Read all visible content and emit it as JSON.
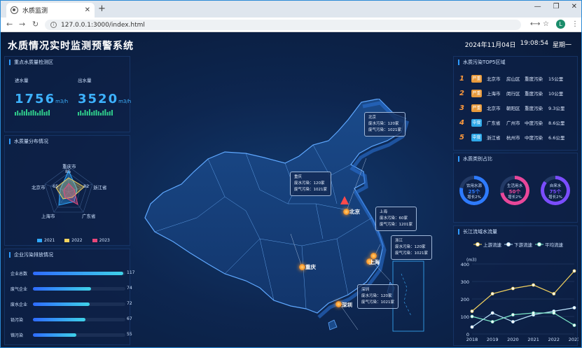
{
  "browser": {
    "tab_title": "水质监测",
    "url": "127.0.0.1:3000/index.html",
    "avatar_letter": "L"
  },
  "header": {
    "title": "水质情况实时监测预警系统",
    "date": "2024年11月04日",
    "time": "19:08:54",
    "weekday": "星期一"
  },
  "panel_inflow": {
    "title": "重点水质量检测区",
    "inflow_label": "进水量",
    "inflow_value": "1756",
    "outflow_label": "出水量",
    "outflow_value": "3520",
    "unit": "m3/h"
  },
  "panel_radar": {
    "title": "水质量分布情况",
    "axes": [
      "重庆市",
      "浙江省",
      "广东省",
      "上海市",
      "北京市"
    ],
    "label_85": "85",
    "label_82": "82",
    "label_65": "65",
    "legend": [
      "2021",
      "2022",
      "2023"
    ],
    "legend_colors": [
      "#2ea8ff",
      "#f4d35e",
      "#e8477a"
    ]
  },
  "panel_enterprise": {
    "title": "企业污染排放情况",
    "rows": [
      {
        "label": "企业总数",
        "value": 117,
        "pct": 0.98
      },
      {
        "label": "废气企业",
        "value": 74,
        "pct": 0.63
      },
      {
        "label": "废水企业",
        "value": 72,
        "pct": 0.61
      },
      {
        "label": "铅污染",
        "value": 67,
        "pct": 0.57
      },
      {
        "label": "铬污染",
        "value": 55,
        "pct": 0.47
      }
    ]
  },
  "panel_top5": {
    "title": "水质污染TOP5区域",
    "rows": [
      {
        "n": "1",
        "level": "严重",
        "prov": "北京市",
        "district": "房山区",
        "kind": "重度污染",
        "dist": "15公里",
        "color": "#e89a3c"
      },
      {
        "n": "2",
        "level": "严重",
        "prov": "上海市",
        "district": "闵行区",
        "kind": "重度污染",
        "dist": "10公里",
        "color": "#e89a3c"
      },
      {
        "n": "3",
        "level": "严重",
        "prov": "北京市",
        "district": "朝阳区",
        "kind": "重度污染",
        "dist": "9.3公里",
        "color": "#e89a3c"
      },
      {
        "n": "4",
        "level": "中度",
        "prov": "广东省",
        "district": "广州市",
        "kind": "中度污染",
        "dist": "8.6公里",
        "color": "#2ea8e8"
      },
      {
        "n": "5",
        "level": "中度",
        "prov": "浙江省",
        "district": "杭州市",
        "kind": "中度污染",
        "dist": "6.6公里",
        "color": "#2ea8e8"
      }
    ]
  },
  "panel_types": {
    "title": "水质类别占比",
    "rings": [
      {
        "name": "饮用水源",
        "value": "25个",
        "growth": "增长2%",
        "color": "#2e7bff",
        "pct": 0.78
      },
      {
        "name": "生活用水",
        "value": "50个",
        "growth": "增长2%",
        "color": "#e8479a",
        "pct": 0.72
      },
      {
        "name": "自来水",
        "value": "75个",
        "growth": "增长2%",
        "color": "#7b4dff",
        "pct": 0.86
      }
    ]
  },
  "panel_flow": {
    "title": "长江流域水流量",
    "legend": [
      "上游流速",
      "下游流速",
      "平均流速"
    ],
    "ylabel": "(m3)"
  },
  "chart_data": {
    "type": "line",
    "title": "长江流域水流量",
    "ylabel": "(m3)",
    "x": [
      "2018",
      "2019",
      "2020",
      "2021",
      "2022",
      "2023"
    ],
    "ylim": [
      0,
      400
    ],
    "yticks": [
      0,
      100,
      200,
      300,
      400
    ],
    "series": [
      {
        "name": "上游流速",
        "values": [
          130,
          230,
          260,
          280,
          230,
          360
        ],
        "color": "#f4d35e"
      },
      {
        "name": "下游流速",
        "values": [
          40,
          120,
          70,
          110,
          130,
          150
        ],
        "color": "#bfe8ff"
      },
      {
        "name": "平均流速",
        "values": [
          100,
          70,
          110,
          120,
          120,
          50
        ],
        "color": "#7de8c8"
      }
    ]
  },
  "map": {
    "cities": [
      {
        "name": "北京",
        "info": [
          "北京",
          "废水污染：120家",
          "废气污染：1021家"
        ]
      },
      {
        "name": "重庆",
        "info": [
          "重庆",
          "废水污染：120家",
          "废气污染：1021家"
        ]
      },
      {
        "name": "上海",
        "info": [
          "上海",
          "废水污染：60家",
          "废气污染：1201家"
        ]
      },
      {
        "name": "浙江",
        "info": [
          "浙江",
          "废水污染：120家",
          "废气污染：1021家"
        ]
      },
      {
        "name": "深圳",
        "info": [
          "深圳",
          "废水污染：120家",
          "废气污染：1021家"
        ]
      }
    ]
  }
}
